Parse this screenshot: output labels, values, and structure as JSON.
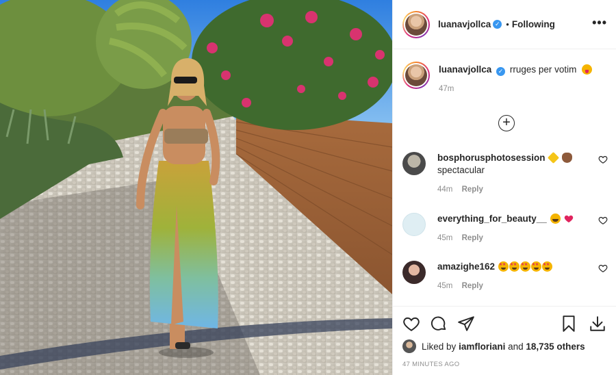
{
  "post": {
    "author": {
      "username": "luanavjollca",
      "verified": true,
      "follow_state": "Following",
      "separator": "•"
    },
    "caption": {
      "username": "luanavjollca",
      "text": "rruges per votim",
      "emoji": "face-with-tongue",
      "time": "47m"
    },
    "comments": [
      {
        "username": "bosphorusphotosession",
        "text": "spectacular",
        "emojis": [
          "sparkles",
          "raised-hand"
        ],
        "time": "44m",
        "reply_label": "Reply"
      },
      {
        "username": "everything_for_beauty__",
        "text": "",
        "emojis": [
          "laughing-tears",
          "red-heart"
        ],
        "time": "45m",
        "reply_label": "Reply"
      },
      {
        "username": "amazighe162",
        "text": "",
        "emojis": [
          "star-struck",
          "star-struck",
          "star-struck",
          "star-struck",
          "star-struck"
        ],
        "time": "45m",
        "reply_label": "Reply"
      }
    ],
    "likes": {
      "prefix": "Liked by",
      "liker": "iamfloriani",
      "joiner": "and",
      "others": "18,735 others"
    },
    "timestamp": "47 MINUTES AGO"
  },
  "icons": {
    "more": "more-options-icon",
    "load_more": "plus-circle-icon",
    "like": "heart-icon",
    "comment": "comment-bubble-icon",
    "share": "paper-plane-icon",
    "save": "bookmark-icon",
    "download": "download-icon"
  },
  "colors": {
    "verified": "#3897f0",
    "border": "#efefef",
    "muted": "#8e8e8e",
    "text": "#262626"
  }
}
